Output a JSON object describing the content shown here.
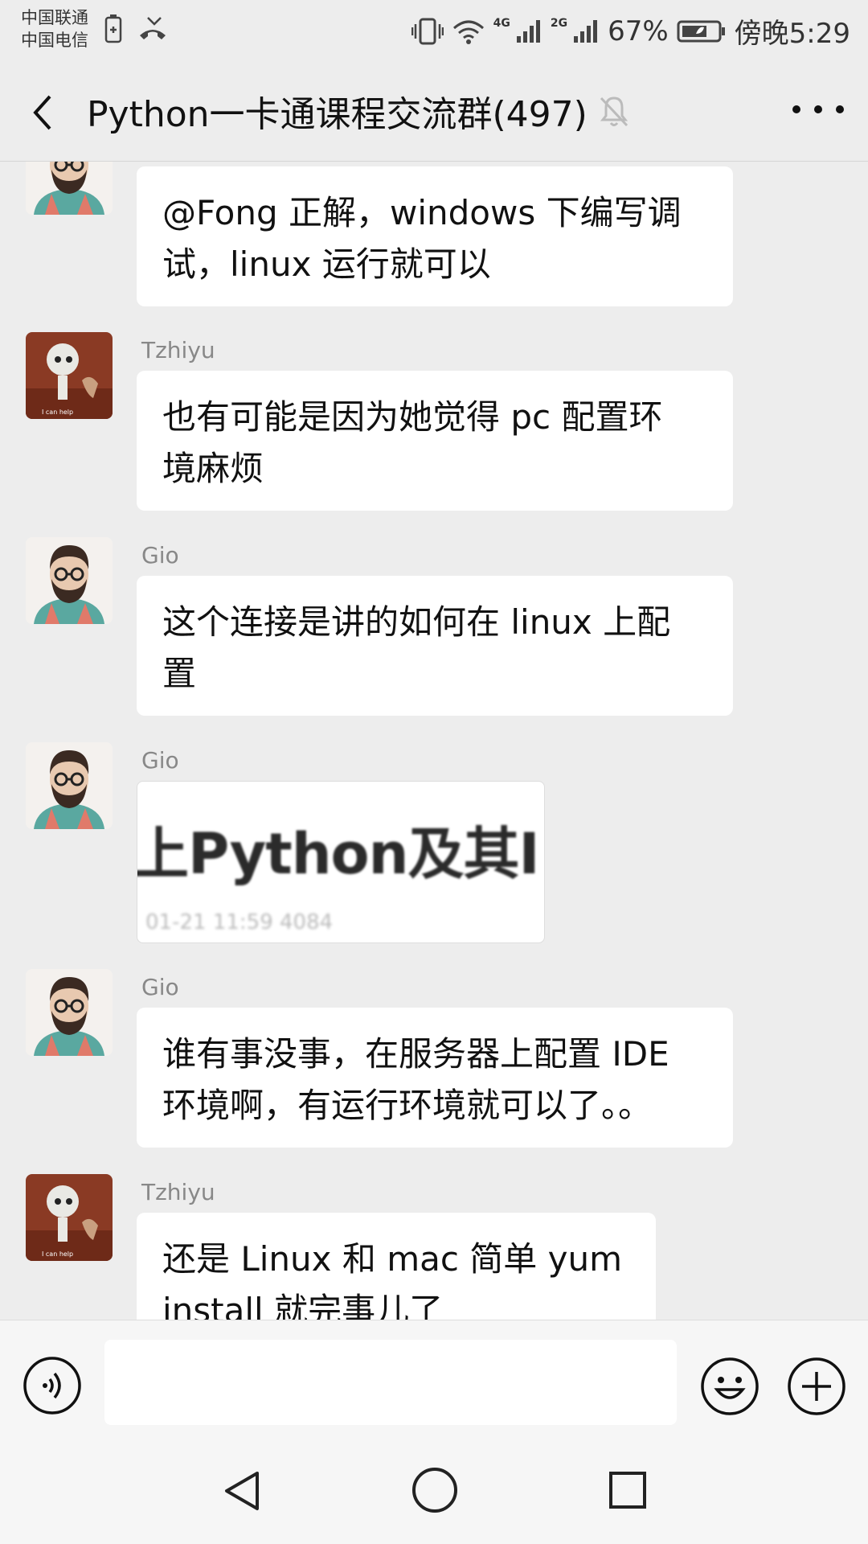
{
  "status": {
    "carrier1": "中国联通",
    "carrier2": "中国电信",
    "net1": "4G",
    "net2": "2G",
    "battery": "67%",
    "time": "傍晚5:29"
  },
  "header": {
    "title": "Python一卡通课程交流群(497)"
  },
  "messages": [
    {
      "sender": "",
      "text": "@Fong 正解，windows 下编写调试，linux 运行就可以",
      "line1": "@Fong 正解，windows 下编写调",
      "line2": "试，linux 运行就可以",
      "avatar": "bearded-man"
    },
    {
      "sender": "Tzhiyu",
      "line1": "也有可能是因为她觉得 pc 配置环",
      "line2": "境麻烦",
      "avatar": "robot"
    },
    {
      "sender": "Gio",
      "line1": "这个连接是讲的如何在 linux 上配",
      "line2": "置",
      "avatar": "bearded-man"
    },
    {
      "sender": "Gio",
      "image_text": "上Python及其I",
      "image_meta": "01-21 11:59   4084",
      "avatar": "bearded-man"
    },
    {
      "sender": "Gio",
      "line1": "谁有事没事，在服务器上配置 IDE",
      "line2": "环境啊，有运行环境就可以了。。",
      "avatar": "bearded-man"
    },
    {
      "sender": "Tzhiyu",
      "line1": "还是 Linux 和 mac 简单  yum",
      "line2": "install 就完事儿了",
      "avatar": "robot"
    }
  ],
  "input": {
    "placeholder": ""
  },
  "colors": {
    "background": "#ededed",
    "bubble": "#ffffff",
    "sender": "#888888"
  }
}
